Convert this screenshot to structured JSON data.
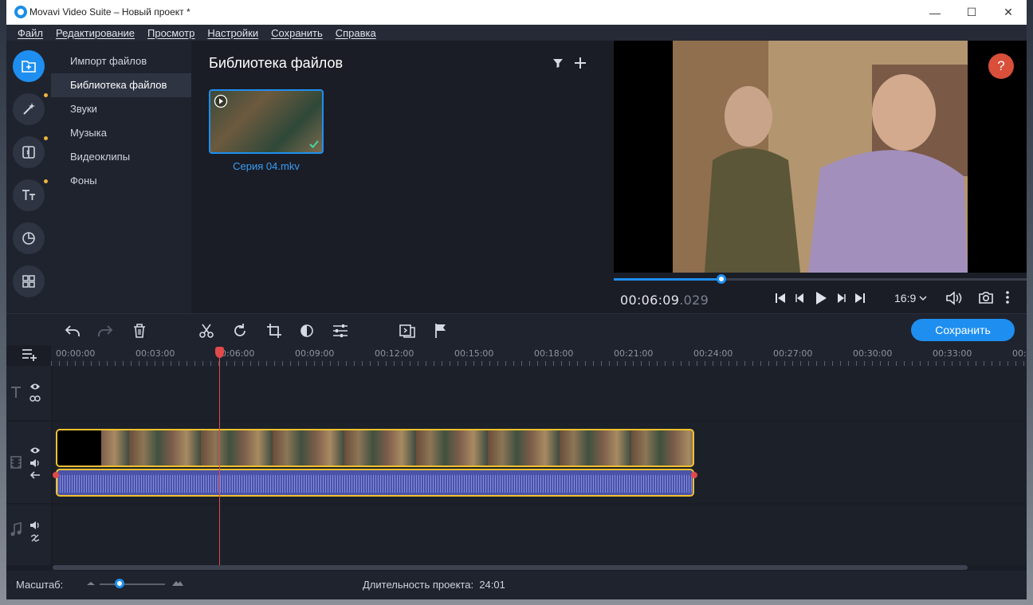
{
  "window": {
    "title": "Movavi Video Suite – Новый проект *",
    "minimize_glyph": "—",
    "maximize_glyph": "☐",
    "close_glyph": "✕"
  },
  "menu": [
    "Файл",
    "Редактирование",
    "Просмотр",
    "Настройки",
    "Сохранить",
    "Справка"
  ],
  "rail": {
    "icons": [
      "import-icon",
      "magic-wand-icon",
      "transitions-icon",
      "titles-icon",
      "stickers-icon",
      "more-tools-icon"
    ]
  },
  "library_nav": [
    {
      "label": "Импорт файлов",
      "selected": false
    },
    {
      "label": "Библиотека файлов",
      "selected": true
    },
    {
      "label": "Звуки",
      "selected": false
    },
    {
      "label": "Музыка",
      "selected": false
    },
    {
      "label": "Видеоклипы",
      "selected": false
    },
    {
      "label": "Фоны",
      "selected": false
    }
  ],
  "library": {
    "title": "Библиотека файлов",
    "file_name": "Серия 04.mkv"
  },
  "player": {
    "timecode_main": "00:06:09",
    "timecode_ms": ".029",
    "aspect": "16:9",
    "progress": 0.26,
    "help_label": "?"
  },
  "toolbar": {
    "save_label": "Сохранить"
  },
  "ruler": [
    "00:00:00",
    "00:03:00",
    "00:06:00",
    "00:09:00",
    "00:12:00",
    "00:15:00",
    "00:18:00",
    "00:21:00",
    "00:24:00",
    "00:27:00",
    "00:30:00",
    "00:33:00",
    "00:"
  ],
  "bottom": {
    "scale_label": "Масштаб:",
    "duration_label": "Длительность проекта:",
    "duration_value": "24:01",
    "zoom_level": 0.3
  },
  "colors": {
    "accent": "#1e8ff0",
    "clip_border": "#f2c12e",
    "playhead": "#e14a4a",
    "help": "#d94f3a"
  }
}
